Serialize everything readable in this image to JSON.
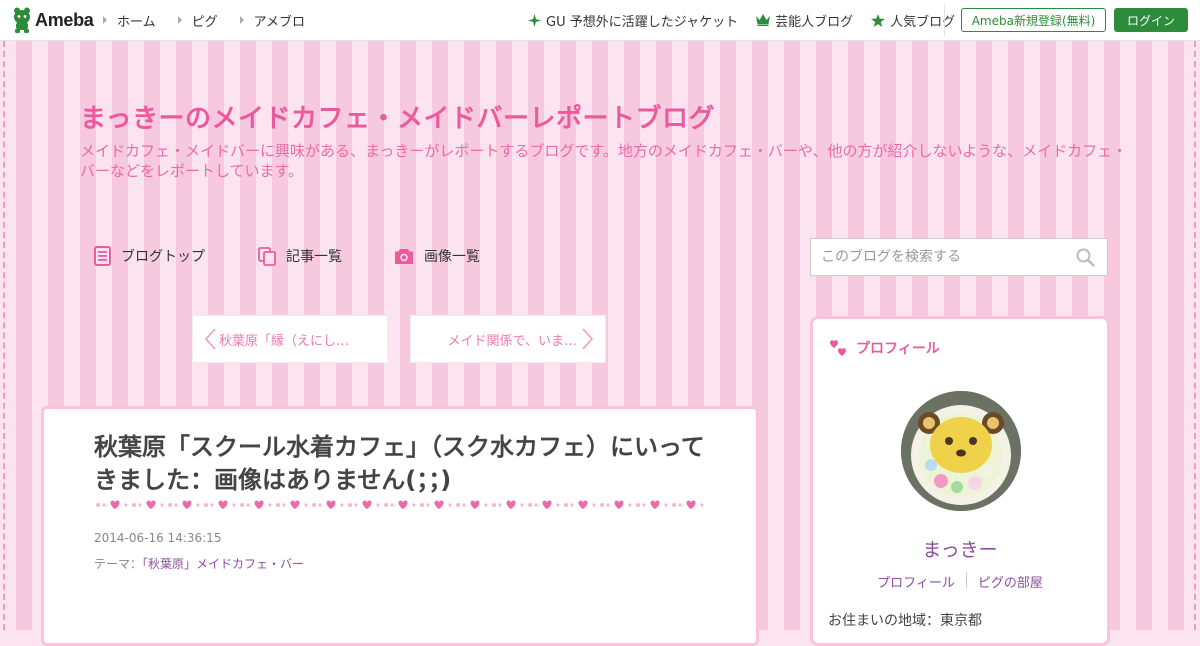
{
  "header": {
    "logo_text": "Ameba",
    "nav": [
      {
        "label": "ホーム"
      },
      {
        "label": "ピグ"
      },
      {
        "label": "アメブロ"
      }
    ],
    "promos": [
      {
        "label": "GU 予想外に活躍したジャケット",
        "icon": "sparkle-icon"
      },
      {
        "label": "芸能人ブログ",
        "icon": "crown-icon"
      },
      {
        "label": "人気ブログ",
        "icon": "star-icon"
      }
    ],
    "register_label": "Ameba新規登録(無料)",
    "login_label": "ログイン"
  },
  "blog": {
    "title": "まっきーのメイドカフェ・メイドバーレポートブログ",
    "description": "メイドカフェ・メイドバーに興味がある、まっきーがレポートするブログです。地方のメイドカフェ・バーや、他の方が紹介しないような、メイドカフェ・バーなどをレポートしています。",
    "nav": {
      "top": "ブログトップ",
      "entries": "記事一覧",
      "images": "画像一覧"
    },
    "search_placeholder": "このブログを検索する"
  },
  "pager": {
    "prev": "秋葉原「縁（えにし…",
    "next": "メイド関係で、いま…"
  },
  "article": {
    "title": "秋葉原「スクール水着カフェ」（スク水カフェ）にいってきました：画像はありません(；；)",
    "date": "2014-06-16 14:36:15",
    "theme_prefix": "テーマ：",
    "theme_link": "「秋葉原」メイドカフェ・バー"
  },
  "profile": {
    "heading": "プロフィール",
    "name": "まっきー",
    "links": [
      "プロフィール",
      "ピグの部屋"
    ],
    "region": "お住まいの地域：東京都"
  },
  "colors": {
    "ameba_green": "#2d8c3c",
    "accent_pink": "#ec5a9d",
    "link_purple": "#8b4f9e",
    "stripe_light": "#fbe4f0",
    "stripe_dark": "#f6c9df"
  }
}
